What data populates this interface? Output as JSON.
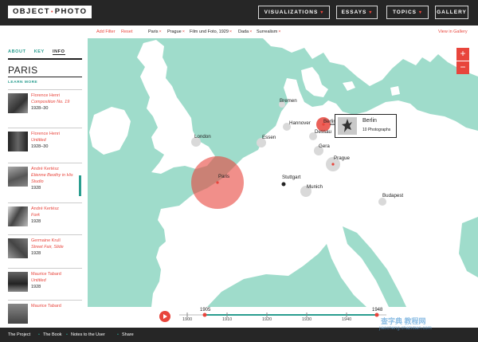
{
  "header": {
    "logo_left": "OBJECT",
    "logo_sep": "•",
    "logo_right": "PHOTO",
    "nav": [
      {
        "label": "VISUALIZATIONS",
        "caret": "▾"
      },
      {
        "label": "ESSAYS",
        "caret": "▾"
      },
      {
        "label": "TOPICS",
        "caret": "▾"
      },
      {
        "label": "GALLERY",
        "caret": ""
      }
    ]
  },
  "sidebar": {
    "tabs": [
      "ABOUT",
      "KEY",
      "INFO"
    ],
    "active_tab": "INFO",
    "place": "PARIS",
    "learn_more": "LEARN MORE",
    "items": [
      {
        "name": "Florence Henri",
        "title": "Composition No. 19",
        "date": "1928–30"
      },
      {
        "name": "Florence Henri",
        "title": "Untitled",
        "date": "1928–30"
      },
      {
        "name": "André Kertész",
        "title": "Etienne Beothy in His Studio",
        "date": "1928"
      },
      {
        "name": "André Kertész",
        "title": "Fork",
        "date": "1928"
      },
      {
        "name": "Germaine Krull",
        "title": "Street Fair, Slide",
        "date": "1928"
      },
      {
        "name": "Maurice Tabard",
        "title": "Untitled",
        "date": "1928"
      },
      {
        "name": "Maurice Tabard",
        "title": "",
        "date": ""
      }
    ]
  },
  "filters": {
    "add_filter": "Add Filter",
    "reset": "Reset",
    "remove_glyph": "×",
    "tags": [
      "Paris",
      "Prague",
      "Film und Foto, 1929",
      "Dada",
      "Surrealism"
    ],
    "view_gallery": "View in Gallery"
  },
  "map": {
    "zoom_in": "+",
    "zoom_out": "−",
    "cities": {
      "bremen": "Bremen",
      "berlin": "Berlin",
      "hannover": "Hannover",
      "london": "London",
      "essen": "Essen",
      "dessau": "Dessau",
      "gera": "Gera",
      "prague": "Prague",
      "paris": "Paris",
      "stuttgart": "Stuttgart",
      "munich": "Munich",
      "budapest": "Budapest"
    },
    "tooltip": {
      "title": "Berlin",
      "subtitle": "10 Photographs"
    },
    "colors": {
      "water": "#9fdccb",
      "land": "#ffffff",
      "bubble_active": "#e8453c",
      "bubble_inactive": "#d9d9d9"
    }
  },
  "timeline": {
    "start_label": "1905",
    "end_label": "1948",
    "ticks": [
      "1900",
      "1910",
      "1920",
      "1930",
      "1940"
    ]
  },
  "footer": {
    "links": [
      "The Project",
      "The Book",
      "Notes to the User",
      "Share"
    ],
    "sep": "•"
  },
  "watermark": {
    "line1": "查字典 教程网",
    "line2": "jiaocheng.chazidian.com"
  }
}
